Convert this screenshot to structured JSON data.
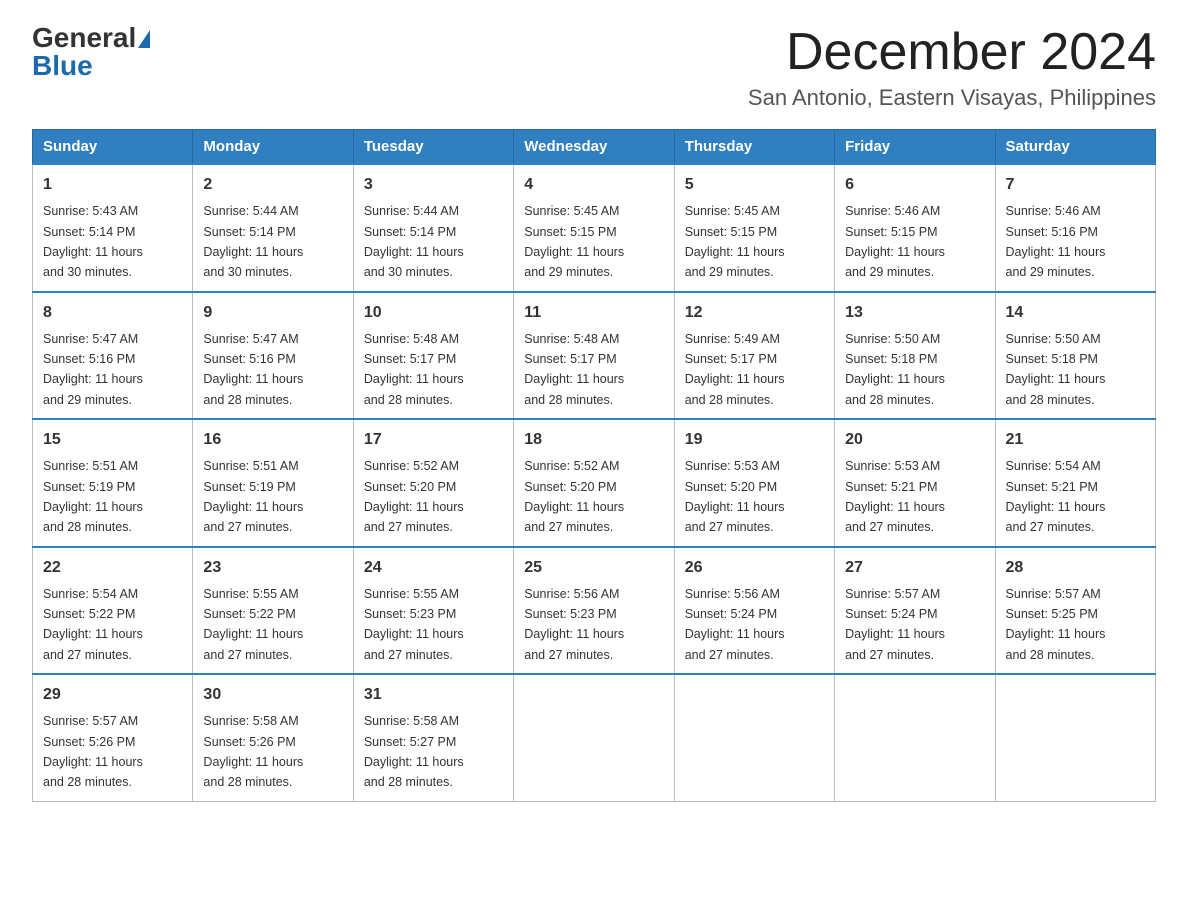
{
  "header": {
    "logo_general": "General",
    "logo_blue": "Blue",
    "month_year": "December 2024",
    "location": "San Antonio, Eastern Visayas, Philippines"
  },
  "days_of_week": [
    "Sunday",
    "Monday",
    "Tuesday",
    "Wednesday",
    "Thursday",
    "Friday",
    "Saturday"
  ],
  "weeks": [
    [
      {
        "day": "1",
        "sunrise": "5:43 AM",
        "sunset": "5:14 PM",
        "daylight": "11 hours and 30 minutes."
      },
      {
        "day": "2",
        "sunrise": "5:44 AM",
        "sunset": "5:14 PM",
        "daylight": "11 hours and 30 minutes."
      },
      {
        "day": "3",
        "sunrise": "5:44 AM",
        "sunset": "5:14 PM",
        "daylight": "11 hours and 30 minutes."
      },
      {
        "day": "4",
        "sunrise": "5:45 AM",
        "sunset": "5:15 PM",
        "daylight": "11 hours and 29 minutes."
      },
      {
        "day": "5",
        "sunrise": "5:45 AM",
        "sunset": "5:15 PM",
        "daylight": "11 hours and 29 minutes."
      },
      {
        "day": "6",
        "sunrise": "5:46 AM",
        "sunset": "5:15 PM",
        "daylight": "11 hours and 29 minutes."
      },
      {
        "day": "7",
        "sunrise": "5:46 AM",
        "sunset": "5:16 PM",
        "daylight": "11 hours and 29 minutes."
      }
    ],
    [
      {
        "day": "8",
        "sunrise": "5:47 AM",
        "sunset": "5:16 PM",
        "daylight": "11 hours and 29 minutes."
      },
      {
        "day": "9",
        "sunrise": "5:47 AM",
        "sunset": "5:16 PM",
        "daylight": "11 hours and 28 minutes."
      },
      {
        "day": "10",
        "sunrise": "5:48 AM",
        "sunset": "5:17 PM",
        "daylight": "11 hours and 28 minutes."
      },
      {
        "day": "11",
        "sunrise": "5:48 AM",
        "sunset": "5:17 PM",
        "daylight": "11 hours and 28 minutes."
      },
      {
        "day": "12",
        "sunrise": "5:49 AM",
        "sunset": "5:17 PM",
        "daylight": "11 hours and 28 minutes."
      },
      {
        "day": "13",
        "sunrise": "5:50 AM",
        "sunset": "5:18 PM",
        "daylight": "11 hours and 28 minutes."
      },
      {
        "day": "14",
        "sunrise": "5:50 AM",
        "sunset": "5:18 PM",
        "daylight": "11 hours and 28 minutes."
      }
    ],
    [
      {
        "day": "15",
        "sunrise": "5:51 AM",
        "sunset": "5:19 PM",
        "daylight": "11 hours and 28 minutes."
      },
      {
        "day": "16",
        "sunrise": "5:51 AM",
        "sunset": "5:19 PM",
        "daylight": "11 hours and 27 minutes."
      },
      {
        "day": "17",
        "sunrise": "5:52 AM",
        "sunset": "5:20 PM",
        "daylight": "11 hours and 27 minutes."
      },
      {
        "day": "18",
        "sunrise": "5:52 AM",
        "sunset": "5:20 PM",
        "daylight": "11 hours and 27 minutes."
      },
      {
        "day": "19",
        "sunrise": "5:53 AM",
        "sunset": "5:20 PM",
        "daylight": "11 hours and 27 minutes."
      },
      {
        "day": "20",
        "sunrise": "5:53 AM",
        "sunset": "5:21 PM",
        "daylight": "11 hours and 27 minutes."
      },
      {
        "day": "21",
        "sunrise": "5:54 AM",
        "sunset": "5:21 PM",
        "daylight": "11 hours and 27 minutes."
      }
    ],
    [
      {
        "day": "22",
        "sunrise": "5:54 AM",
        "sunset": "5:22 PM",
        "daylight": "11 hours and 27 minutes."
      },
      {
        "day": "23",
        "sunrise": "5:55 AM",
        "sunset": "5:22 PM",
        "daylight": "11 hours and 27 minutes."
      },
      {
        "day": "24",
        "sunrise": "5:55 AM",
        "sunset": "5:23 PM",
        "daylight": "11 hours and 27 minutes."
      },
      {
        "day": "25",
        "sunrise": "5:56 AM",
        "sunset": "5:23 PM",
        "daylight": "11 hours and 27 minutes."
      },
      {
        "day": "26",
        "sunrise": "5:56 AM",
        "sunset": "5:24 PM",
        "daylight": "11 hours and 27 minutes."
      },
      {
        "day": "27",
        "sunrise": "5:57 AM",
        "sunset": "5:24 PM",
        "daylight": "11 hours and 27 minutes."
      },
      {
        "day": "28",
        "sunrise": "5:57 AM",
        "sunset": "5:25 PM",
        "daylight": "11 hours and 28 minutes."
      }
    ],
    [
      {
        "day": "29",
        "sunrise": "5:57 AM",
        "sunset": "5:26 PM",
        "daylight": "11 hours and 28 minutes."
      },
      {
        "day": "30",
        "sunrise": "5:58 AM",
        "sunset": "5:26 PM",
        "daylight": "11 hours and 28 minutes."
      },
      {
        "day": "31",
        "sunrise": "5:58 AM",
        "sunset": "5:27 PM",
        "daylight": "11 hours and 28 minutes."
      },
      null,
      null,
      null,
      null
    ]
  ],
  "labels": {
    "sunrise": "Sunrise:",
    "sunset": "Sunset:",
    "daylight": "Daylight:"
  }
}
